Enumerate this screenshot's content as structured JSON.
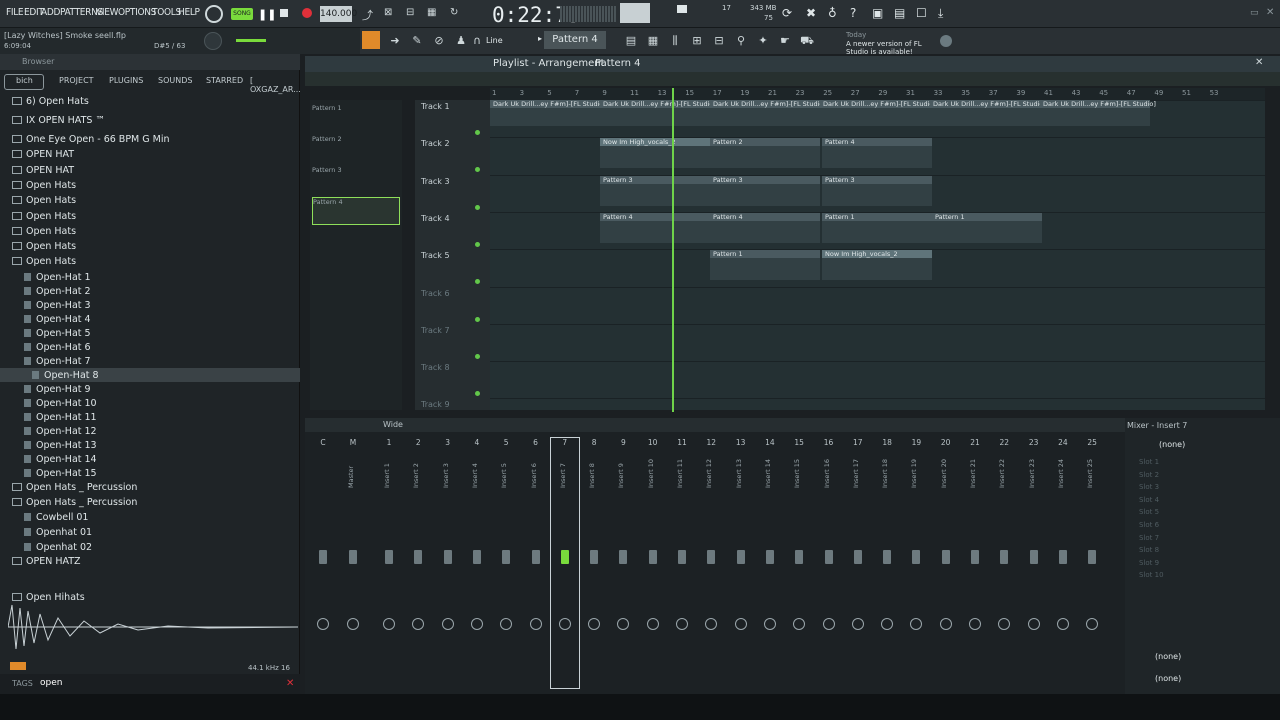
{
  "menu": [
    "FILE",
    "EDIT",
    "ADD",
    "PATTERNS",
    "VIEW",
    "OPTIONS",
    "TOOLS",
    "HELP"
  ],
  "transport": {
    "song_label": "SONG",
    "tempo": "140.000",
    "time": "0:22:75",
    "cpu": "17",
    "mem": "343 MB",
    "poly": "75"
  },
  "hint": {
    "file_name": "[Lazy Witches] Smoke seell.flp",
    "time": "6:09:04",
    "position": "D#5 / 63"
  },
  "toolbar": {
    "snap": "Line",
    "pattern": "Pattern 4",
    "news_date": "Today",
    "news_text": "A newer version of FL Studio is available!"
  },
  "browser": {
    "title": "Browser",
    "tabs": [
      "bich",
      "PROJECT",
      "PLUGINS",
      "SOUNDS",
      "STARRED",
      "[ OXGAZ_AR..."
    ],
    "items": [
      {
        "label": "6) Open Hats",
        "type": "folder"
      },
      {
        "label": "IX OPEN HATS ™",
        "type": "folder"
      },
      {
        "label": "One Eye Open - 66 BPM G Min",
        "type": "folder"
      },
      {
        "label": "OPEN HAT",
        "type": "folder"
      },
      {
        "label": "OPEN HAT",
        "type": "folder"
      },
      {
        "label": "Open Hats",
        "type": "folder"
      },
      {
        "label": "Open Hats",
        "type": "folder"
      },
      {
        "label": "Open Hats",
        "type": "folder"
      },
      {
        "label": "Open Hats",
        "type": "folder"
      },
      {
        "label": "Open Hats",
        "type": "folder"
      },
      {
        "label": "Open Hats",
        "type": "folder"
      },
      {
        "label": "Open-Hat 1",
        "type": "file"
      },
      {
        "label": "Open-Hat 2",
        "type": "file"
      },
      {
        "label": "Open-Hat 3",
        "type": "file"
      },
      {
        "label": "Open-Hat 4",
        "type": "file"
      },
      {
        "label": "Open-Hat 5",
        "type": "file"
      },
      {
        "label": "Open-Hat 6",
        "type": "file"
      },
      {
        "label": "Open-Hat 7",
        "type": "file"
      },
      {
        "label": "Open-Hat 8",
        "type": "file",
        "selected": true
      },
      {
        "label": "Open-Hat 9",
        "type": "file"
      },
      {
        "label": "Open-Hat 10",
        "type": "file"
      },
      {
        "label": "Open-Hat 11",
        "type": "file"
      },
      {
        "label": "Open-Hat 12",
        "type": "file"
      },
      {
        "label": "Open-Hat 13",
        "type": "file"
      },
      {
        "label": "Open-Hat 14",
        "type": "file"
      },
      {
        "label": "Open-Hat 15",
        "type": "file"
      },
      {
        "label": "Open Hats _ Percussion",
        "type": "folder"
      },
      {
        "label": "Open Hats _ Percussion",
        "type": "folder"
      },
      {
        "label": "Cowbell 01",
        "type": "file"
      },
      {
        "label": "Openhat 01",
        "type": "file"
      },
      {
        "label": "Openhat 02",
        "type": "file"
      },
      {
        "label": "OPEN HATZ",
        "type": "folder"
      },
      {
        "label": "Open Hihats",
        "type": "folder"
      }
    ],
    "sample_rate": "44.1 kHz 16",
    "tags_label": "TAGS",
    "tags_value": "open"
  },
  "playlist": {
    "title": "Playlist - Arrangement",
    "pattern": "Pattern 4",
    "patterns": [
      "Pattern 1",
      "Pattern 2",
      "Pattern 3",
      "Pattern 4"
    ],
    "tracks": [
      "Track 1",
      "Track 2",
      "Track 3",
      "Track 4",
      "Track 5",
      "Track 6",
      "Track 7",
      "Track 8",
      "Track 9"
    ],
    "ruler": [
      "1",
      "3",
      "5",
      "7",
      "9",
      "11",
      "13",
      "15",
      "17",
      "19",
      "21",
      "23",
      "25",
      "27",
      "29",
      "31",
      "33",
      "35",
      "37",
      "39",
      "41",
      "43",
      "45",
      "47",
      "49",
      "51",
      "53"
    ],
    "clip_audio": "Dark Uk Drill...ey F#m]-[FL Studio]",
    "clip_vocal": "Now Im High_vocals_2"
  },
  "mixer": {
    "view": "Wide",
    "strips": [
      "C",
      "M",
      "1",
      "2",
      "3",
      "4",
      "5",
      "6",
      "7",
      "8",
      "9",
      "10",
      "11",
      "12",
      "13",
      "14",
      "15",
      "16",
      "17",
      "18",
      "19",
      "20",
      "21",
      "22",
      "23",
      "24",
      "25"
    ],
    "names": [
      "",
      "Master",
      "Insert 1",
      "Insert 2",
      "Insert 3",
      "Insert 4",
      "Insert 5",
      "Insert 6",
      "Insert 7",
      "Insert 8",
      "Insert 9",
      "Insert 10",
      "Insert 11",
      "Insert 12",
      "Insert 13",
      "Insert 14",
      "Insert 15",
      "Insert 16",
      "Insert 17",
      "Insert 18",
      "Insert 19",
      "Insert 20",
      "Insert 21",
      "Insert 22",
      "Insert 23",
      "Insert 24",
      "Insert 25"
    ],
    "insert_title": "Mixer - Insert 7",
    "input": "(none)",
    "slots": [
      "Slot 1",
      "Slot 2",
      "Slot 3",
      "Slot 4",
      "Slot 5",
      "Slot 6",
      "Slot 7",
      "Slot 8",
      "Slot 9",
      "Slot 10"
    ],
    "output1": "(none)",
    "output2": "(none)"
  },
  "colors": {
    "accent": "#7adb3c",
    "playhead": "#6fd34a"
  }
}
